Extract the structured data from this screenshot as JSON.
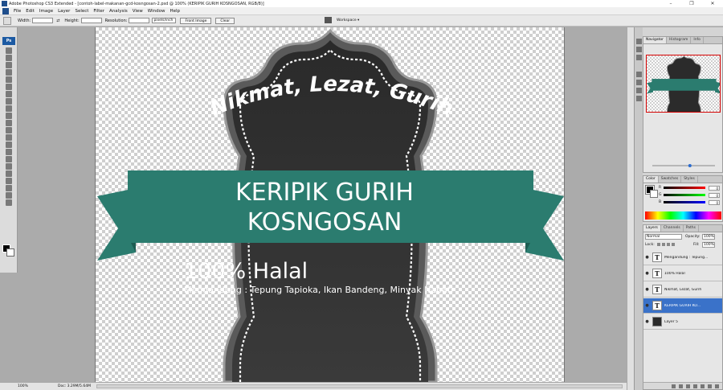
{
  "window": {
    "title": "Adobe Photoshop CS3 Extended - [contoh-label-makanan-gcd-kosngosan-2.psd @ 100% (KERIPIK GURIH KOSNGOSAN, RGB/8)]",
    "controls": {
      "minimize": "–",
      "restore": "❐",
      "close": "✕"
    }
  },
  "menu": [
    "File",
    "Edit",
    "Image",
    "Layer",
    "Select",
    "Filter",
    "Analysis",
    "View",
    "Window",
    "Help"
  ],
  "options": {
    "width_label": "Width:",
    "width_value": "",
    "height_label": "Height:",
    "height_value": "",
    "resolution_label": "Resolution:",
    "resolution_value": "",
    "unit": "pixels/inch",
    "front_image": "Front Image",
    "clear": "Clear",
    "workspace": "Workspace ▾"
  },
  "toolbox": {
    "logo": "Ps"
  },
  "artwork": {
    "arc_text": "Nikmat, Lezat, Gurih",
    "banner_line1": "KERIPIK GURIH",
    "banner_line2": "KOSNGOSAN",
    "halal": "100% Halal",
    "ingredients": "Mengandung : Tepung Tapioka, Ikan Bandeng, Minyak Nabati",
    "colors": {
      "badge": "#262626",
      "banner": "#2b7c6f",
      "banner_dark": "#1d5c52",
      "stitch": "#ffffff"
    }
  },
  "status": {
    "zoom": "100%",
    "doc": "Doc: 3.29M/5.64M"
  },
  "navigator": {
    "tabs": [
      "Navigator",
      "Histogram",
      "Info"
    ],
    "zoom_value": 0.6
  },
  "color_panel": {
    "tabs": [
      "Color",
      "Swatches",
      "Styles"
    ],
    "rows": [
      {
        "label": "R",
        "value": "0"
      },
      {
        "label": "G",
        "value": "0"
      },
      {
        "label": "B",
        "value": "0"
      }
    ]
  },
  "layers_panel": {
    "tabs": [
      "Layers",
      "Channels",
      "Paths"
    ],
    "blend_mode": "Normal",
    "opacity_label": "Opacity:",
    "opacity": "100%",
    "lock_label": "Lock:",
    "fill_label": "Fill:",
    "fill": "100%",
    "layers": [
      {
        "name": "Mengandung : Tepung...",
        "thumb": "T",
        "selected": false
      },
      {
        "name": "100% Halal",
        "thumb": "T",
        "selected": false
      },
      {
        "name": "Nikmat, Lezat, Gurih",
        "thumb": "T",
        "selected": false
      },
      {
        "name": "KERIPIK GURIH KO...",
        "thumb": "T",
        "selected": true
      },
      {
        "name": "Layer 5",
        "thumb": "",
        "selected": false
      }
    ]
  }
}
